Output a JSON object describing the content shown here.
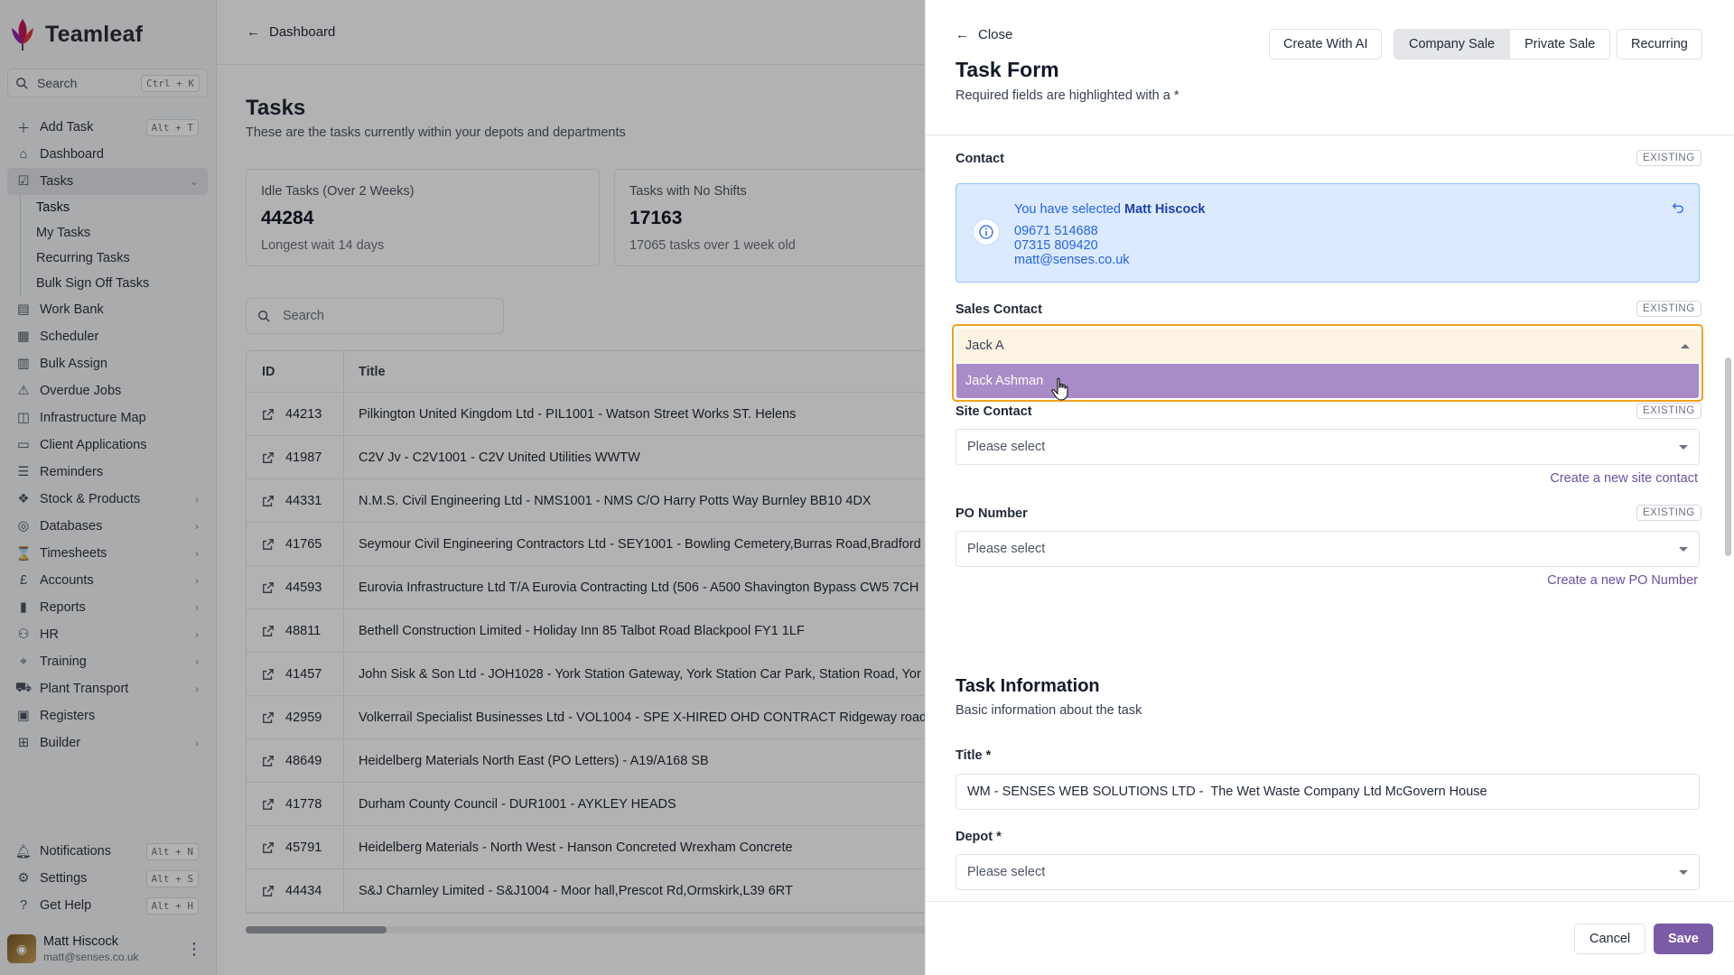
{
  "app": {
    "name": "Teamleaf",
    "search_label": "Search",
    "search_shortcut": "Ctrl + K"
  },
  "sidebar": {
    "items": [
      {
        "label": "Add Task",
        "icon": "plus-icon",
        "shortcut": "Alt + T"
      },
      {
        "label": "Dashboard",
        "icon": "home-icon"
      },
      {
        "label": "Tasks",
        "icon": "check-square-icon",
        "active": true,
        "expanded": true
      },
      {
        "label": "Work Bank",
        "icon": "clipboard-icon"
      },
      {
        "label": "Scheduler",
        "icon": "calendar-icon"
      },
      {
        "label": "Bulk Assign",
        "icon": "clipboard-list-icon"
      },
      {
        "label": "Overdue Jobs",
        "icon": "warning-icon"
      },
      {
        "label": "Infrastructure Map",
        "icon": "map-icon"
      },
      {
        "label": "Client Applications",
        "icon": "monitor-icon"
      },
      {
        "label": "Reminders",
        "icon": "list-icon"
      },
      {
        "label": "Stock & Products",
        "icon": "boxes-icon",
        "chevron": true
      },
      {
        "label": "Databases",
        "icon": "database-icon",
        "chevron": true
      },
      {
        "label": "Timesheets",
        "icon": "hourglass-icon",
        "chevron": true
      },
      {
        "label": "Accounts",
        "icon": "pound-icon",
        "chevron": true
      },
      {
        "label": "Reports",
        "icon": "bar-chart-icon",
        "chevron": true
      },
      {
        "label": "HR",
        "icon": "users-icon",
        "chevron": true
      },
      {
        "label": "Training",
        "icon": "graduation-cap-icon",
        "chevron": true
      },
      {
        "label": "Plant Transport",
        "icon": "truck-icon",
        "chevron": true
      },
      {
        "label": "Registers",
        "icon": "book-icon"
      },
      {
        "label": "Builder",
        "icon": "grid-icon",
        "chevron": true
      }
    ],
    "sub_items": [
      "Tasks",
      "My Tasks",
      "Recurring Tasks",
      "Bulk Sign Off Tasks"
    ],
    "bottom": [
      {
        "label": "Notifications",
        "icon": "bell-icon",
        "shortcut": "Alt + N"
      },
      {
        "label": "Settings",
        "icon": "gear-icon",
        "shortcut": "Alt + S"
      },
      {
        "label": "Get Help",
        "icon": "help-circle-icon",
        "shortcut": "Alt + H"
      }
    ],
    "user": {
      "name": "Matt Hiscock",
      "email": "matt@senses.co.uk"
    }
  },
  "main": {
    "breadcrumb": "Dashboard",
    "title": "Tasks",
    "subtitle": "These are the tasks currently within your depots and departments",
    "stats": [
      {
        "label": "Idle Tasks (Over 2 Weeks)",
        "value": "44284",
        "foot": "Longest wait 14 days"
      },
      {
        "label": "Tasks with No Shifts",
        "value": "17163",
        "foot": "17065 tasks over 1 week old"
      }
    ],
    "search_placeholder": "Search",
    "table": {
      "headers": [
        "ID",
        "Title"
      ],
      "rows": [
        {
          "id": "44213",
          "title": "Pilkington United Kingdom Ltd - PIL1001 - Watson Street Works ST. Helens"
        },
        {
          "id": "41987",
          "title": "C2V Jv - C2V1001 - C2V United Utilities WWTW"
        },
        {
          "id": "44331",
          "title": "N.M.S. Civil Engineering Ltd - NMS1001 - NMS C/O Harry Potts Way Burnley BB10 4DX"
        },
        {
          "id": "41765",
          "title": "Seymour Civil Engineering Contractors Ltd - SEY1001 - Bowling Cemetery,Burras Road,Bradford"
        },
        {
          "id": "44593",
          "title": "Eurovia Infrastructure Ltd T/A Eurovia Contracting Ltd (506 - A500 Shavington Bypass CW5 7CH"
        },
        {
          "id": "48811",
          "title": "Bethell Construction Limited - Holiday Inn 85 Talbot Road Blackpool FY1 1LF"
        },
        {
          "id": "41457",
          "title": "John Sisk & Son Ltd - JOH1028 - York Station Gateway, York Station Car Park, Station Road, Yor"
        },
        {
          "id": "42959",
          "title": "Volkerrail Specialist Businesses Ltd - VOL1004 - SPE X-HIRED OHD CONTRACT Ridgeway road/"
        },
        {
          "id": "48649",
          "title": "Heidelberg Materials North East (PO Letters) - A19/A168 SB"
        },
        {
          "id": "41778",
          "title": "Durham County Council - DUR1001 - AYKLEY HEADS"
        },
        {
          "id": "45791",
          "title": "Heidelberg Materials - North West - Hanson Concreted Wrexham Concrete"
        },
        {
          "id": "44434",
          "title": "S&J Charnley Limited - S&J1004 - Moor hall,Prescot Rd,Ormskirk,L39 6RT"
        }
      ]
    }
  },
  "drawer": {
    "close_label": "Close",
    "title": "Task Form",
    "subtitle": "Required fields are highlighted with a *",
    "buttons": {
      "create_ai": "Create With AI",
      "company_sale": "Company Sale",
      "private_sale": "Private Sale",
      "recurring": "Recurring"
    },
    "existing_badge": "EXISTING",
    "contact": {
      "label": "Contact",
      "selected_prefix": "You have selected",
      "selected_name": "Matt Hiscock",
      "phone1": "09671 514688",
      "phone2": "07315 809420",
      "email": "matt@senses.co.uk"
    },
    "sales_contact": {
      "label": "Sales Contact",
      "value": "Jack A",
      "option": "Jack Ashman"
    },
    "site_contact": {
      "label": "Site Contact",
      "placeholder": "Please select",
      "create_link": "Create a new site contact"
    },
    "po_number": {
      "label": "PO Number",
      "placeholder": "Please select",
      "create_link": "Create a new PO Number"
    },
    "task_info": {
      "title": "Task Information",
      "subtitle": "Basic information about the task"
    },
    "title_field": {
      "label": "Title *",
      "value": "WM - SENSES WEB SOLUTIONS LTD -  The Wet Waste Company Ltd McGovern House"
    },
    "depot_field": {
      "label": "Depot *",
      "placeholder": "Please select"
    },
    "footer": {
      "cancel": "Cancel",
      "save": "Save"
    }
  }
}
